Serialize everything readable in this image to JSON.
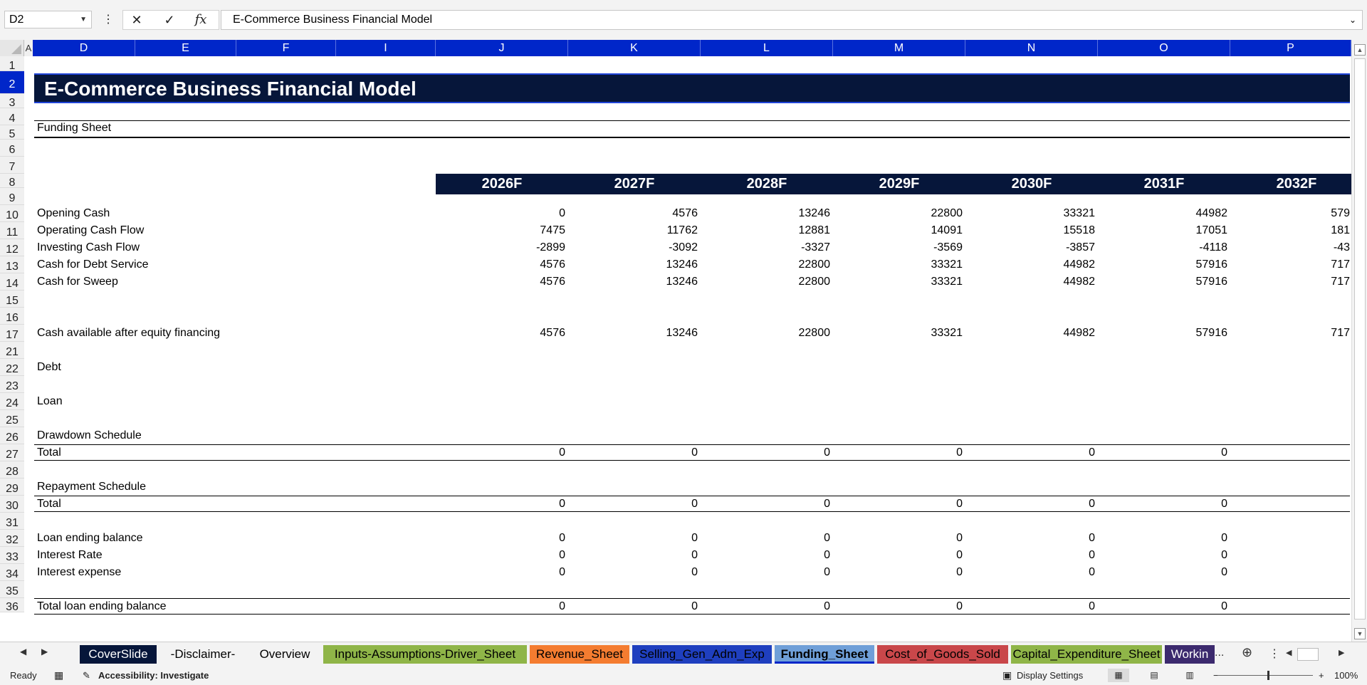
{
  "formula_bar": {
    "name_box": "D2",
    "formula": "E-Commerce Business Financial Model",
    "fx": "fx"
  },
  "columns": [
    "A",
    "D",
    "E",
    "F",
    "I",
    "J",
    "K",
    "L",
    "M",
    "N",
    "O",
    "P"
  ],
  "rows": [
    "1",
    "2",
    "3",
    "4",
    "5",
    "6",
    "7",
    "8",
    "9",
    "10",
    "11",
    "12",
    "13",
    "14",
    "15",
    "16",
    "17",
    "21",
    "22",
    "23",
    "24",
    "25",
    "26",
    "27",
    "28",
    "29",
    "30",
    "31",
    "32",
    "33",
    "34",
    "35",
    "36"
  ],
  "sheet": {
    "banner_title": "E-Commerce Business Financial Model",
    "subtitle": "Funding Sheet",
    "years": [
      "2026F",
      "2027F",
      "2028F",
      "2029F",
      "2030F",
      "2031F",
      "2032F"
    ],
    "opening_cash": {
      "label": "Opening Cash",
      "values": [
        "0",
        "4576",
        "13246",
        "22800",
        "33321",
        "44982",
        "579"
      ]
    },
    "operating_cf": {
      "label": "Operating Cash Flow",
      "values": [
        "7475",
        "11762",
        "12881",
        "14091",
        "15518",
        "17051",
        "181"
      ]
    },
    "investing_cf": {
      "label": "Investing Cash Flow",
      "values": [
        "-2899",
        "-3092",
        "-3327",
        "-3569",
        "-3857",
        "-4118",
        "-43"
      ]
    },
    "debt_service": {
      "label": "Cash for Debt Service",
      "values": [
        "4576",
        "13246",
        "22800",
        "33321",
        "44982",
        "57916",
        "717"
      ]
    },
    "sweep": {
      "label": "Cash for Sweep",
      "values": [
        "4576",
        "13246",
        "22800",
        "33321",
        "44982",
        "57916",
        "717"
      ]
    },
    "after_equity": {
      "label": "Cash available after equity financing",
      "values": [
        "4576",
        "13246",
        "22800",
        "33321",
        "44982",
        "57916",
        "717"
      ]
    },
    "debt_label": "Debt",
    "loan_label": "Loan",
    "drawdown_label": "Drawdown Schedule",
    "drawdown_total": {
      "label": "Total",
      "values": [
        "0",
        "0",
        "0",
        "0",
        "0",
        "0"
      ]
    },
    "repayment_label": "Repayment Schedule",
    "repayment_total": {
      "label": "Total",
      "values": [
        "0",
        "0",
        "0",
        "0",
        "0",
        "0"
      ]
    },
    "loan_ending": {
      "label": "Loan ending balance",
      "values": [
        "0",
        "0",
        "0",
        "0",
        "0",
        "0"
      ]
    },
    "interest_rate": {
      "label": "Interest Rate",
      "values": [
        "0",
        "0",
        "0",
        "0",
        "0",
        "0"
      ]
    },
    "interest_expense": {
      "label": "Interest expense",
      "values": [
        "0",
        "0",
        "0",
        "0",
        "0",
        "0"
      ]
    },
    "total_loan": {
      "label": "Total loan ending balance",
      "values": [
        "0",
        "0",
        "0",
        "0",
        "0",
        "0"
      ]
    }
  },
  "tabs": [
    {
      "label": "CoverSlide",
      "bg": "#06163a",
      "fg": "#ffffff"
    },
    {
      "label": "-Disclaimer-",
      "bg": "#f3f3f3",
      "fg": "#000000"
    },
    {
      "label": "Overview",
      "bg": "#f3f3f3",
      "fg": "#000000"
    },
    {
      "label": "Inputs-Assumptions-Driver_Sheet",
      "bg": "#8fb548",
      "fg": "#000000"
    },
    {
      "label": "Revenue_Sheet",
      "bg": "#f47c30",
      "fg": "#000000"
    },
    {
      "label": "Selling_Gen_Adm_Exp",
      "bg": "#1f3fbf",
      "fg": "#000000"
    },
    {
      "label": "Funding_Sheet",
      "bg": "#6f9fd8",
      "fg": "#000000"
    },
    {
      "label": "Cost_of_Goods_Sold",
      "bg": "#c9474a",
      "fg": "#000000"
    },
    {
      "label": "Capital_Expenditure_Sheet",
      "bg": "#8fb548",
      "fg": "#000000"
    },
    {
      "label": "Workin",
      "bg": "#3c2a6e",
      "fg": "#ffffff"
    }
  ],
  "status": {
    "ready": "Ready",
    "accessibility": "Accessibility: Investigate",
    "display_settings": "Display Settings",
    "zoom": "100%",
    "more": "..."
  }
}
